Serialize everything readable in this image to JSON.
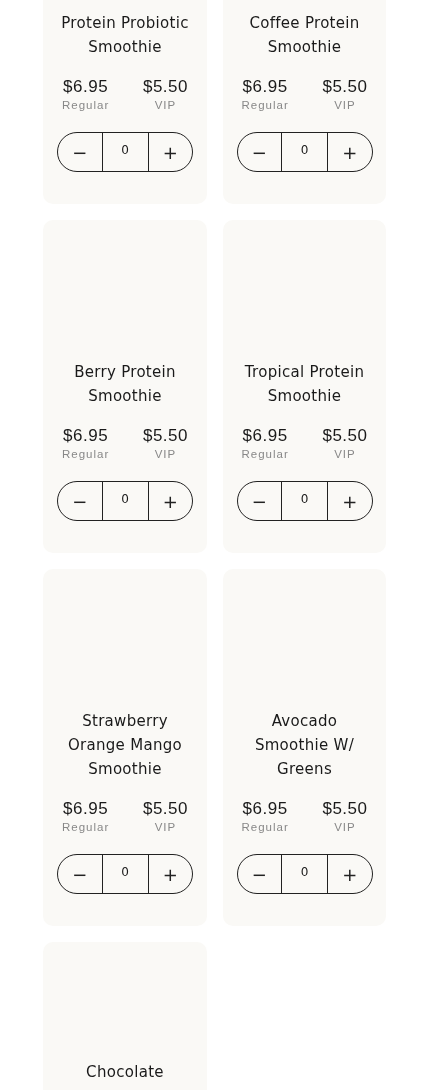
{
  "products": [
    {
      "name": "Protein Probiotic Smoothie",
      "regular_price": "$6.95",
      "regular_label": "Regular",
      "vip_price": "$5.50",
      "vip_label": "VIP",
      "quantity": "0",
      "minus": "−",
      "plus": "+"
    },
    {
      "name": "Coffee Protein Smoothie",
      "regular_price": "$6.95",
      "regular_label": "Regular",
      "vip_price": "$5.50",
      "vip_label": "VIP",
      "quantity": "0",
      "minus": "−",
      "plus": "+"
    },
    {
      "name": "Berry Protein Smoothie",
      "regular_price": "$6.95",
      "regular_label": "Regular",
      "vip_price": "$5.50",
      "vip_label": "VIP",
      "quantity": "0",
      "minus": "−",
      "plus": "+"
    },
    {
      "name": "Tropical Protein Smoothie",
      "regular_price": "$6.95",
      "regular_label": "Regular",
      "vip_price": "$5.50",
      "vip_label": "VIP",
      "quantity": "0",
      "minus": "−",
      "plus": "+"
    },
    {
      "name": "Strawberry Orange Mango Smoothie",
      "regular_price": "$6.95",
      "regular_label": "Regular",
      "vip_price": "$5.50",
      "vip_label": "VIP",
      "quantity": "0",
      "minus": "−",
      "plus": "+"
    },
    {
      "name": "Avocado Smoothie W/ Greens",
      "regular_price": "$6.95",
      "regular_label": "Regular",
      "vip_price": "$5.50",
      "vip_label": "VIP",
      "quantity": "0",
      "minus": "−",
      "plus": "+"
    },
    {
      "name": "Chocolate"
    }
  ]
}
